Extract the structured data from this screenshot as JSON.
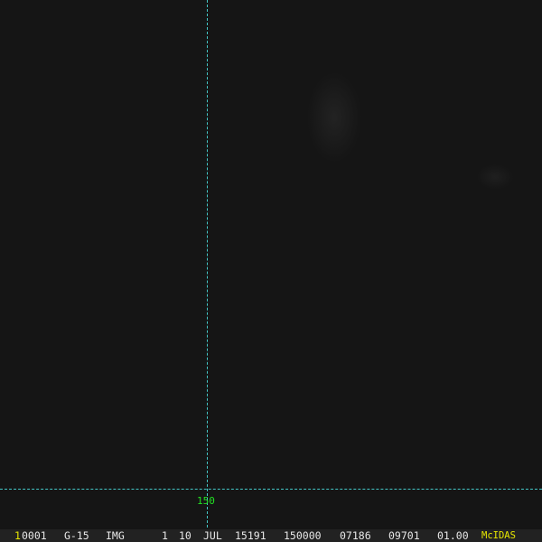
{
  "overlay": {
    "grid_label": "150"
  },
  "status_bar": {
    "frame": "1",
    "area": "0001",
    "satellite": "G-15",
    "type": "IMG",
    "band": "1",
    "day": "10",
    "month": "JUL",
    "julian_date": "15191",
    "time": "150000",
    "line": "07186",
    "element": "09701",
    "resolution": "01.00",
    "brand": "McIDAS"
  },
  "colors": {
    "grid": "#4ce6e6",
    "label": "#22e022",
    "brand": "#e8e800"
  }
}
